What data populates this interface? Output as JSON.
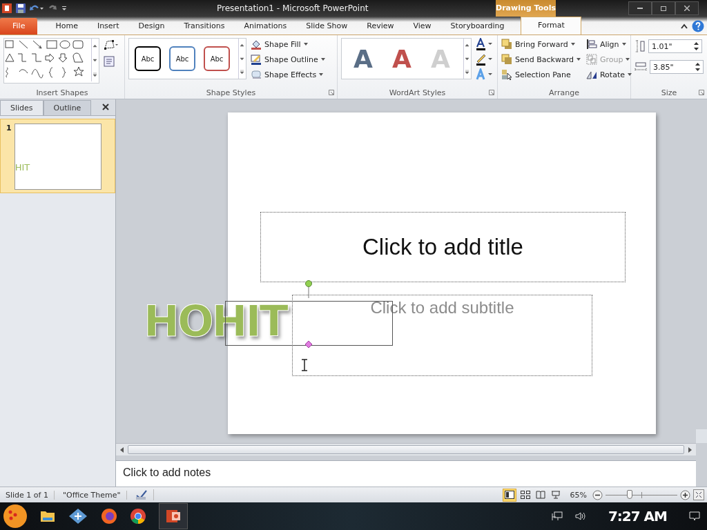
{
  "window": {
    "title": "Presentation1 - Microsoft PowerPoint"
  },
  "contextual_group": "Drawing Tools",
  "tabs": [
    {
      "label": "File",
      "kind": "file",
      "selected": false
    },
    {
      "label": "Home",
      "kind": "normal",
      "selected": false
    },
    {
      "label": "Insert",
      "kind": "normal",
      "selected": false
    },
    {
      "label": "Design",
      "kind": "normal",
      "selected": false
    },
    {
      "label": "Transitions",
      "kind": "normal",
      "selected": false
    },
    {
      "label": "Animations",
      "kind": "normal",
      "selected": false
    },
    {
      "label": "Slide Show",
      "kind": "normal",
      "selected": false
    },
    {
      "label": "Review",
      "kind": "normal",
      "selected": false
    },
    {
      "label": "View",
      "kind": "normal",
      "selected": false
    },
    {
      "label": "Storyboarding",
      "kind": "normal",
      "selected": false
    },
    {
      "label": "Format",
      "kind": "contextual",
      "selected": true
    }
  ],
  "ribbon": {
    "groups": [
      {
        "kind": "shapes",
        "label": "Insert Shapes"
      },
      {
        "kind": "styles",
        "label": "Shape Styles",
        "gallery": [
          {
            "label": "Abc",
            "color": "#000000"
          },
          {
            "label": "Abc",
            "color": "#4f81bd"
          },
          {
            "label": "Abc",
            "color": "#c0504d"
          }
        ],
        "commands": [
          {
            "label": "Shape Fill",
            "has_menu": true,
            "disabled": false
          },
          {
            "label": "Shape Outline",
            "has_menu": true,
            "disabled": false
          },
          {
            "label": "Shape Effects",
            "has_menu": true,
            "disabled": false
          }
        ]
      },
      {
        "kind": "wordart",
        "label": "WordArt Styles",
        "gallery": [
          {
            "label": "A",
            "color": "#5a6e86"
          },
          {
            "label": "A",
            "color": "#c0504d"
          },
          {
            "label": "A",
            "color": "#cfcfcf"
          }
        ]
      },
      {
        "kind": "arrange",
        "label": "Arrange",
        "commands": [
          {
            "label": "Bring Forward",
            "has_menu": true,
            "disabled": false
          },
          {
            "label": "Send Backward",
            "has_menu": true,
            "disabled": false
          },
          {
            "label": "Selection Pane",
            "has_menu": false,
            "disabled": false
          },
          {
            "label": "Align",
            "has_menu": true,
            "disabled": false
          },
          {
            "label": "Group",
            "has_menu": true,
            "disabled": true
          },
          {
            "label": "Rotate",
            "has_menu": true,
            "disabled": false
          }
        ]
      },
      {
        "kind": "size",
        "label": "Size",
        "fields": [
          {
            "kind": "height",
            "value": "1.01\""
          },
          {
            "kind": "width",
            "value": "3.85\""
          }
        ]
      }
    ]
  },
  "pane": {
    "tabs": [
      {
        "label": "Slides",
        "selected": true
      },
      {
        "label": "Outline",
        "selected": false
      }
    ],
    "thumbnails": [
      {
        "number": "1",
        "text": "HIT",
        "selected": true
      }
    ]
  },
  "slide": {
    "title_placeholder": "Click to add title",
    "subtitle_placeholder": "Click to add subtitle",
    "wordart": "HOHIT"
  },
  "notes": {
    "placeholder": "Click to add notes"
  },
  "status_bar": {
    "slide": "Slide 1 of 1",
    "theme": "\"Office Theme\"",
    "views": [
      {
        "kind": "normal",
        "selected": true
      },
      {
        "kind": "sorter",
        "selected": false
      },
      {
        "kind": "reading",
        "selected": false
      },
      {
        "kind": "show",
        "selected": false
      }
    ],
    "zoom": "65%",
    "zoom_slider": {
      "level": 0.34
    }
  },
  "taskbar": {
    "apps": [
      {
        "kind": "folder"
      },
      {
        "kind": "app"
      },
      {
        "kind": "firefox"
      },
      {
        "kind": "chrome"
      },
      {
        "kind": "powerpoint"
      }
    ],
    "clock": "7:27 AM"
  }
}
